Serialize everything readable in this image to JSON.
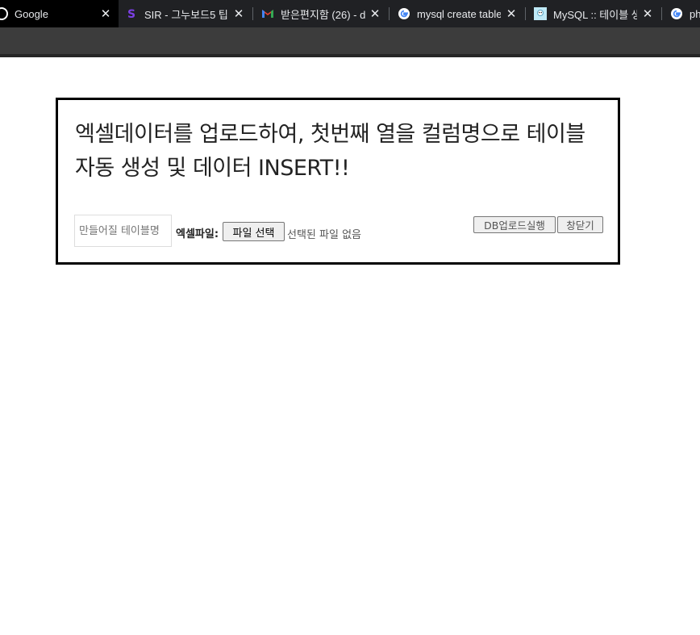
{
  "browser": {
    "tabs": [
      {
        "title": "Google",
        "icon": "google-icon",
        "active": true
      },
      {
        "title": "SIR - 그누보드5 팁",
        "icon": "sir-logo-icon",
        "active": false
      },
      {
        "title": "받은편지함 (26) - d",
        "icon": "gmail-icon",
        "active": false
      },
      {
        "title": "mysql create table",
        "icon": "google-icon",
        "active": false
      },
      {
        "title": "MySQL :: 테이블 생",
        "icon": "mysql-site-icon",
        "active": false
      },
      {
        "title": "ph",
        "icon": "google-icon",
        "active": false
      }
    ]
  },
  "panel": {
    "title": "엑셀데이터를 업로드하여, 첫번째 열을 컬럼명으로 테이블 자동 생성 및 데이터 INSERT!!",
    "table_name_placeholder": "만들어질 테이블명",
    "file_label": "엑셀파일:",
    "file_button": "파일 선택",
    "file_status": "선택된 파일 없음",
    "upload_button": "DB업로드실행",
    "close_button": "창닫기"
  }
}
